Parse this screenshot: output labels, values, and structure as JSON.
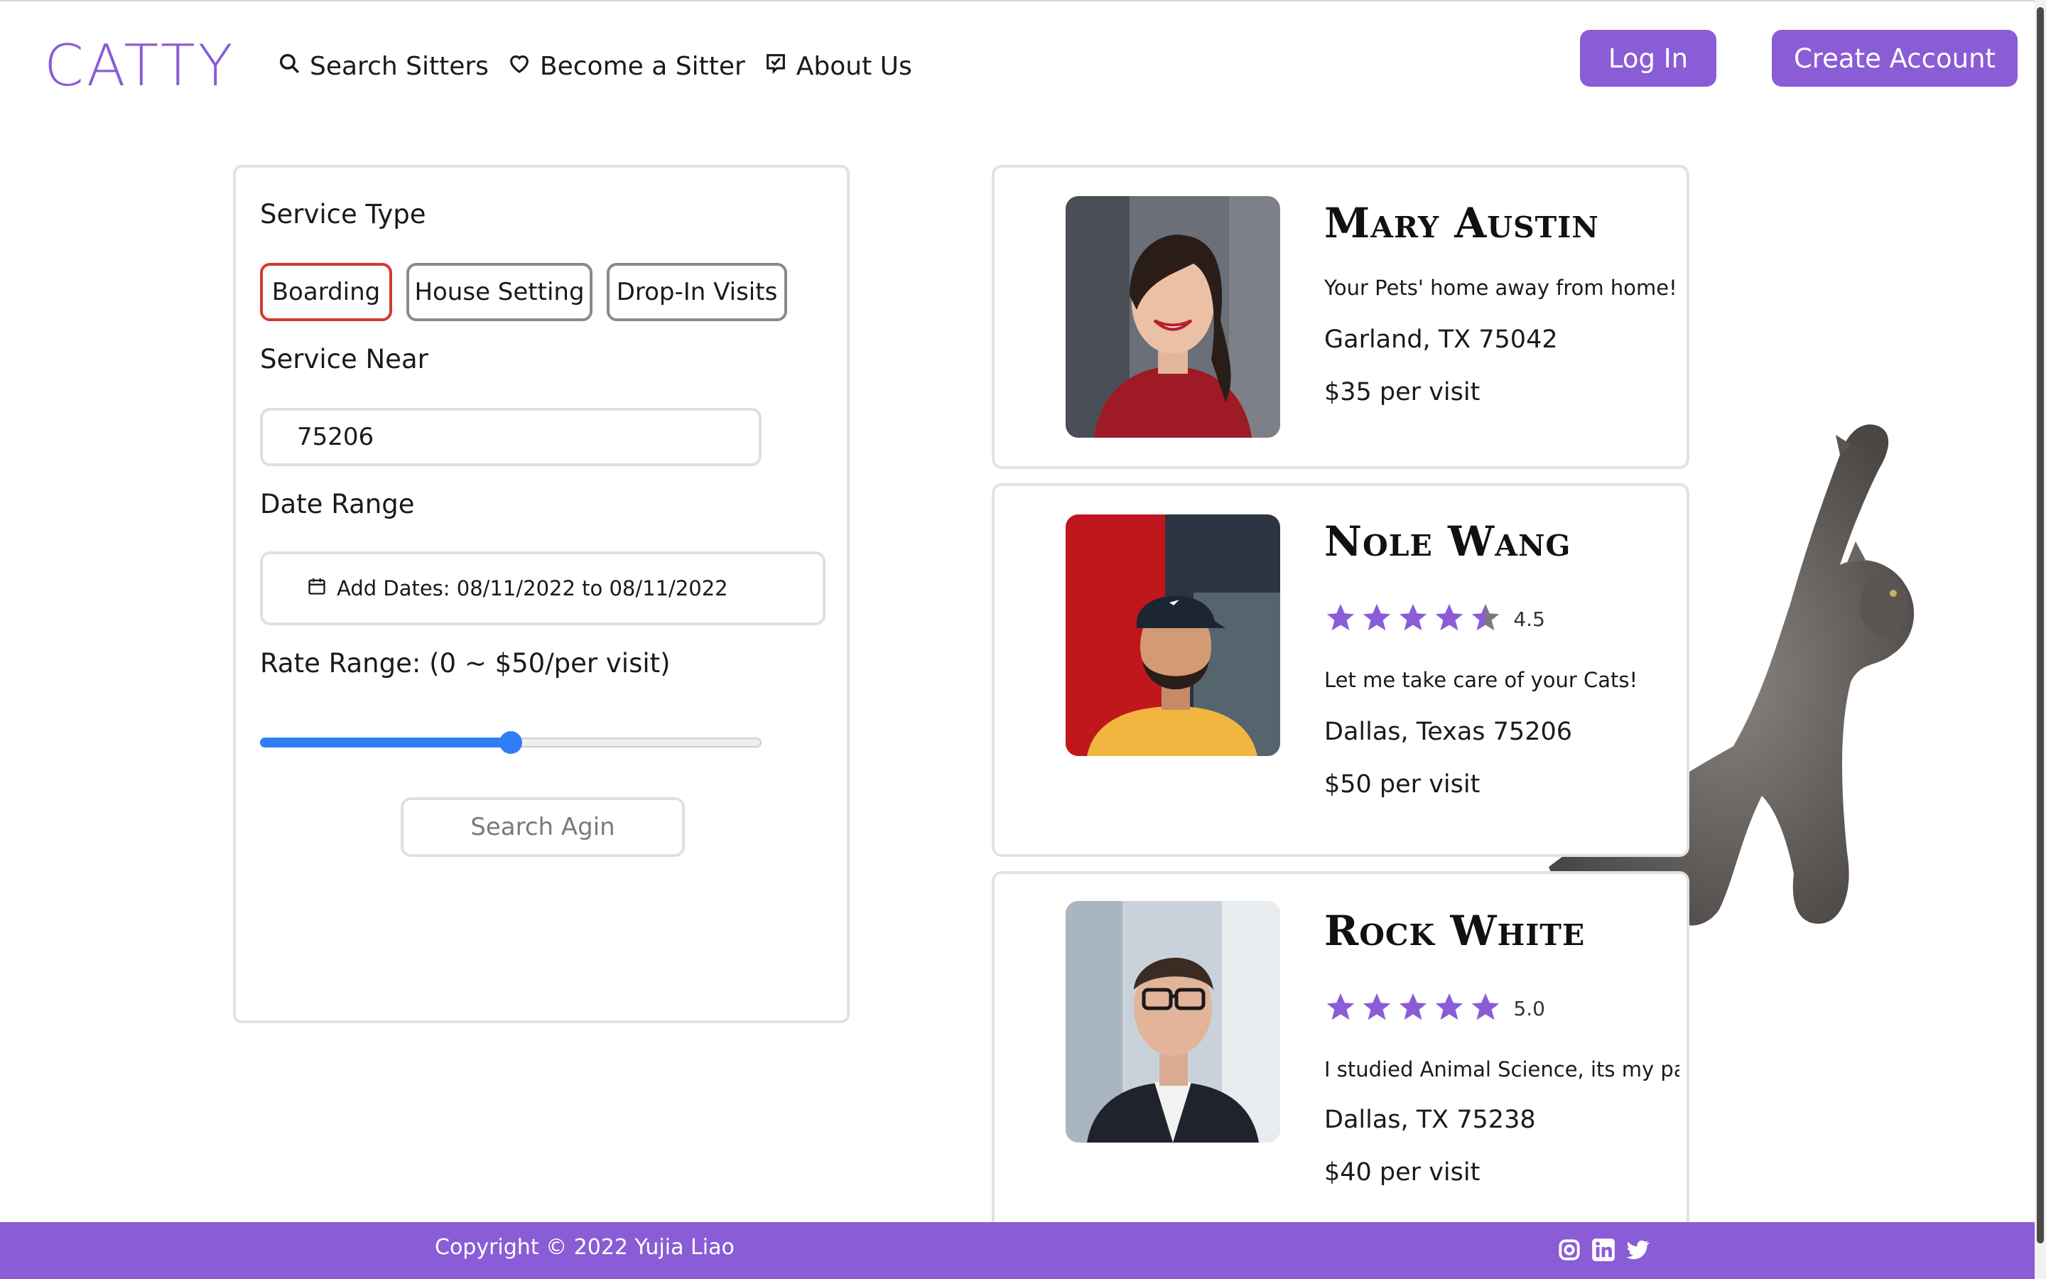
{
  "header": {
    "logo": "CATTY",
    "nav": [
      {
        "label": "Search Sitters",
        "icon": "search-icon"
      },
      {
        "label": "Become a Sitter",
        "icon": "heart-icon"
      },
      {
        "label": "About Us",
        "icon": "check-square-icon"
      }
    ],
    "login_label": "Log In",
    "create_account_label": "Create Account"
  },
  "filters": {
    "service_type_label": "Service Type",
    "service_types": [
      {
        "label": "Boarding",
        "active": true
      },
      {
        "label": "House Setting",
        "active": false
      },
      {
        "label": "Drop-In Visits",
        "active": false
      }
    ],
    "service_near_label": "Service Near",
    "zip_value": "75206",
    "date_range_label": "Date Range",
    "dates_value": "Add Dates: 08/11/2022 to 08/11/2022",
    "rate_range_label": "Rate Range: (0 ~ $50/per visit)",
    "rate_slider_fraction": 0.5,
    "search_again_label": "Search Agin"
  },
  "sitters": [
    {
      "name": "Mary Austin",
      "rating": null,
      "tagline": "Your Pets' home away from home!",
      "location": "Garland, TX 75042",
      "price": "$35 per visit"
    },
    {
      "name": "Nole Wang",
      "rating": "4.5",
      "rating_value": 4.5,
      "tagline": "Let me take care of your Cats!",
      "location": "Dallas, Texas 75206",
      "price": "$50 per visit"
    },
    {
      "name": "Rock White",
      "rating": "5.0",
      "rating_value": 5.0,
      "tagline": "I studied Animal Science, its my pa",
      "location": "Dallas, TX 75238",
      "price": "$40 per visit"
    }
  ],
  "footer": {
    "copyright": "Copyright © 2022 Yujia Liao",
    "social_icons": [
      "instagram-icon",
      "linkedin-icon",
      "twitter-icon"
    ]
  },
  "colors": {
    "brand_purple": "#8a5cd6",
    "active_chip_border": "#d43a2f",
    "slider_blue": "#2f7ef5",
    "star_purple": "#8a5cd6"
  }
}
